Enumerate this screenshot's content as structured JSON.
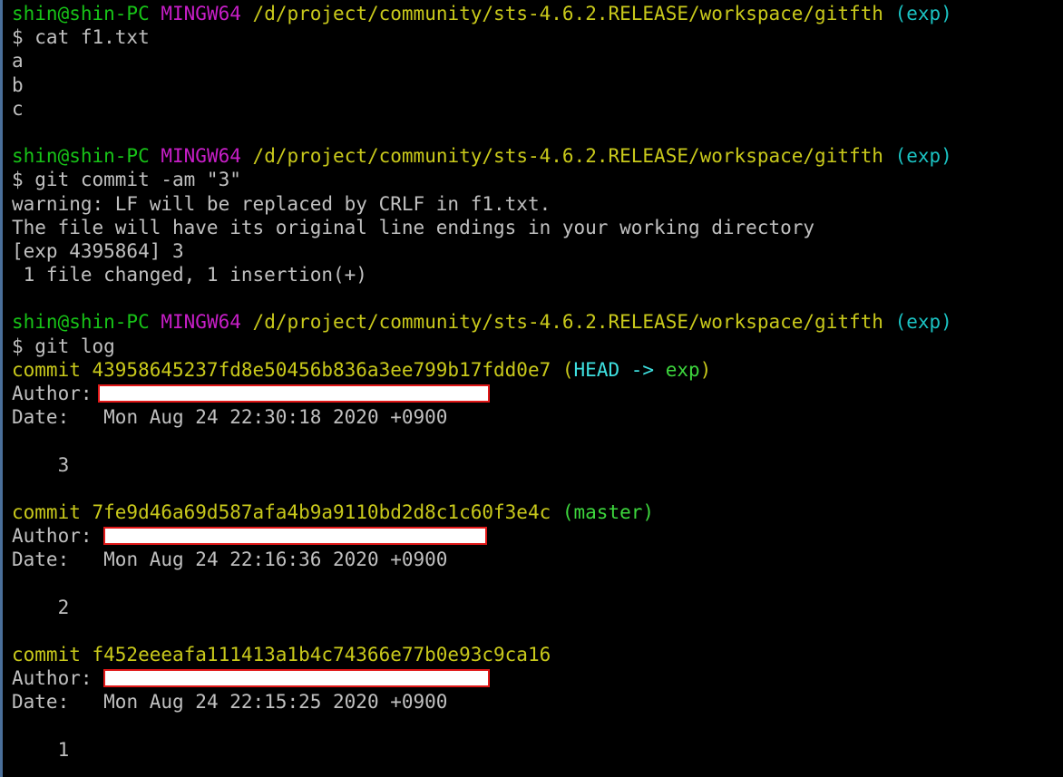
{
  "prompt": {
    "user_host": "shin@shin-PC",
    "env": "MINGW64",
    "path": "/d/project/community/sts-4.6.2.RELEASE/workspace/gitfth",
    "branch": "(exp)"
  },
  "cmd1": "$ cat f1.txt",
  "cat_output": [
    "a",
    "b",
    "c"
  ],
  "cmd2": "$ git commit -am \"3\"",
  "commit_output": [
    "warning: LF will be replaced by CRLF in f1.txt.",
    "The file will have its original line endings in your working directory",
    "[exp 4395864] 3",
    " 1 file changed, 1 insertion(+)"
  ],
  "cmd3": "$ git log",
  "log": {
    "author_label": "Author:",
    "date_label": "Date:",
    "c1": {
      "hash": "commit 43958645237fd8e50456b836a3ee799b17fdd0e7",
      "ref_open": " (",
      "head": "HEAD",
      "arrow": " -> ",
      "branch": "exp",
      "ref_close": ")",
      "date": "Mon Aug 24 22:30:18 2020 +0900",
      "message": "3"
    },
    "c2": {
      "hash": "commit 7fe9d46a69d587afa4b9a9110bd2d8c1c60f3e4c",
      "ref": " (master)",
      "date": "Mon Aug 24 22:16:36 2020 +0900",
      "message": "2"
    },
    "c3": {
      "hash": "commit f452eeeafa111413a1b4c74366e77b0e93c9ca16",
      "date": "Mon Aug 24 22:15:25 2020 +0900",
      "message": "1"
    }
  }
}
